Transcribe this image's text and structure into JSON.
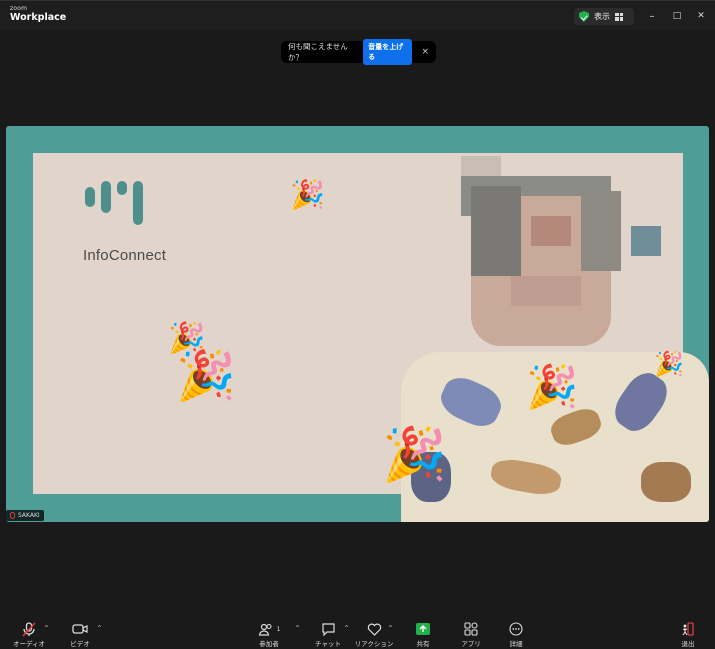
{
  "app": {
    "logo_small": "zoom",
    "logo_big": "Workplace"
  },
  "titlebar": {
    "view_label": "表示",
    "minimize": "–",
    "maximize": "□",
    "close": "✕"
  },
  "notice": {
    "text": "何も聞こえませんか？",
    "button": "音量を上げる",
    "close": "×"
  },
  "slide": {
    "brand": "InfoConnect"
  },
  "participant": {
    "name": "SAKAKI"
  },
  "toolbar": {
    "audio": "オーディオ",
    "video": "ビデオ",
    "participants": "参加者",
    "participants_count": "1",
    "chat": "チャット",
    "reactions": "リアクション",
    "share": "共有",
    "apps": "アプリ",
    "more": "詳細",
    "leave": "退出"
  },
  "colors": {
    "accent": "#0e71eb",
    "share_green": "#22b14c",
    "stage_teal": "#4e9d96",
    "slide_bg": "#e1d5cb"
  }
}
